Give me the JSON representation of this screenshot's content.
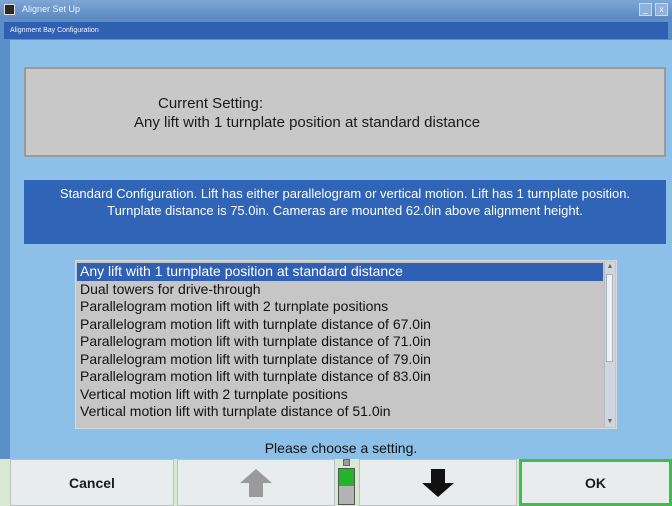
{
  "window": {
    "title": "Aligner Set Up",
    "subtitle": "Alignment Bay Configuration",
    "minimize_glyph": "_",
    "close_glyph": "x"
  },
  "current_setting": {
    "label": "Current Setting:",
    "value": "Any lift with 1 turnplate position at standard distance"
  },
  "description": "Standard Configuration.  Lift has either parallelogram or vertical motion.  Lift has 1 turnplate position.  Turnplate distance is 75.0in.  Cameras are mounted 62.0in above alignment height.",
  "options": [
    "Any lift with 1 turnplate position at standard distance",
    "Dual towers for drive-through",
    "Parallelogram motion lift with 2 turnplate positions",
    "Parallelogram motion lift with turnplate distance of 67.0in",
    "Parallelogram motion lift with turnplate distance of 71.0in",
    "Parallelogram motion lift with turnplate distance of 79.0in",
    "Parallelogram motion lift with turnplate distance of 83.0in",
    "Vertical motion lift with 2 turnplate positions",
    "Vertical motion lift with turnplate distance of 51.0in"
  ],
  "selected_index": 0,
  "prompt": "Please choose a setting.",
  "buttons": {
    "cancel": "Cancel",
    "ok": "OK",
    "up_icon": "up-arrow-icon",
    "down_icon": "down-arrow-icon"
  },
  "colors": {
    "accent_blue": "#2f60b4",
    "panel_bg": "#8dc0e8",
    "ok_border": "#3fbd4c",
    "indicator_green": "#22b52a"
  }
}
